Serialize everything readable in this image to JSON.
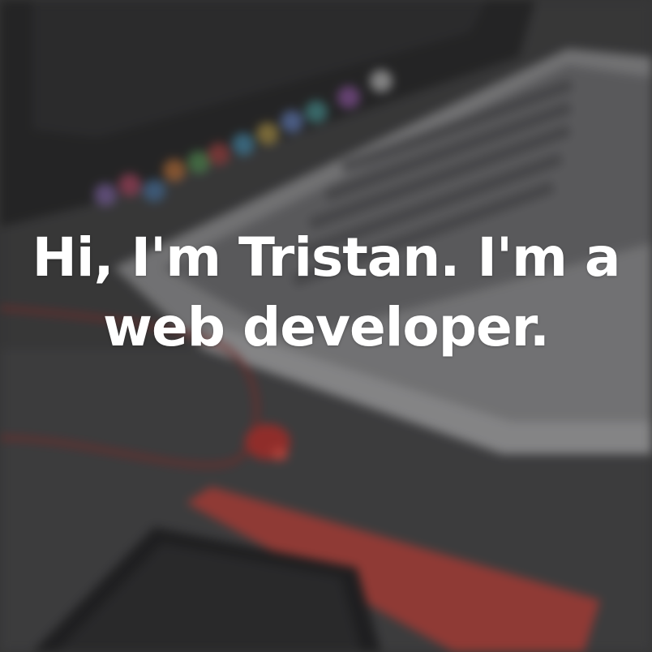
{
  "hero": {
    "headline_line1": "Hi, I'm Tristan. I'm a",
    "headline_line2": "web developer.",
    "background": "blurred-laptop-desk-photo",
    "text_color": "#ffffff",
    "accent_color": "#d5473f"
  }
}
